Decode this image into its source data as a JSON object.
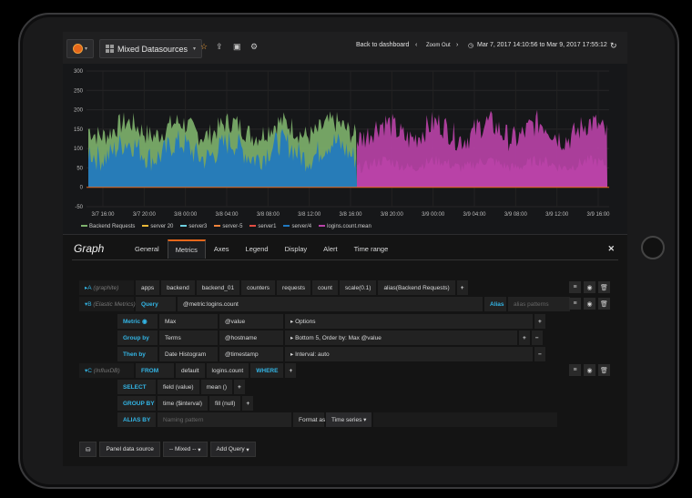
{
  "navbar": {
    "dashboard_title": "Mixed Datasources",
    "back_label": "Back to dashboard",
    "zoom_label": "Zoom Out",
    "time_range": "Mar 7, 2017 14:10:56 to Mar 9, 2017 17:55:12"
  },
  "chart_data": {
    "type": "area",
    "yticks": [
      "300",
      "250",
      "200",
      "150",
      "100",
      "50",
      "0",
      "-50"
    ],
    "ylim": [
      -50,
      300
    ],
    "xticks": [
      "3/7 16:00",
      "3/7 20:00",
      "3/8 00:00",
      "3/8 04:00",
      "3/8 08:00",
      "3/8 12:00",
      "3/8 16:00",
      "3/8 20:00",
      "3/9 00:00",
      "3/9 04:00",
      "3/9 08:00",
      "3/9 12:00",
      "3/9 16:00"
    ],
    "series": [
      {
        "name": "Backend Requests",
        "color": "#7eb26d"
      },
      {
        "name": "server 20",
        "color": "#eab839"
      },
      {
        "name": "server3",
        "color": "#6ed0e0"
      },
      {
        "name": "server-5",
        "color": "#ef843c"
      },
      {
        "name": "server1",
        "color": "#e24d42"
      },
      {
        "name": "server/4",
        "color": "#1f78c1"
      },
      {
        "name": "logins.count.mean",
        "color": "#ba43a9"
      }
    ]
  },
  "editor": {
    "title": "Graph",
    "tabs": [
      "General",
      "Metrics",
      "Axes",
      "Legend",
      "Display",
      "Alert",
      "Time range"
    ],
    "rowA": {
      "ref": "A",
      "ds": "(graphite)",
      "segments": [
        "apps",
        "backend",
        "backend_01",
        "counters",
        "requests",
        "count",
        "scale(0.1)",
        "alias(Backend Requests)"
      ]
    },
    "rowB": {
      "ref": "B",
      "ds": "(Elastic Metrics)",
      "query_label": "Query",
      "query_value": "@metric:logins.count",
      "alias_label": "Alias",
      "alias_placeholder": "alias patterns",
      "metric_label": "Metric",
      "metric_agg": "Max",
      "metric_field": "@value",
      "metric_opts": "Options",
      "groupby_label": "Group by",
      "groupby_agg": "Terms",
      "groupby_field": "@hostname",
      "groupby_opts": "Bottom 5, Order by: Max @value",
      "thenby_label": "Then by",
      "thenby_agg": "Date Histogram",
      "thenby_field": "@timestamp",
      "thenby_opts": "Interval: auto"
    },
    "rowC": {
      "ref": "C",
      "ds": "(InfluxDB)",
      "from_label": "FROM",
      "from_policy": "default",
      "from_measurement": "logins.count",
      "where_label": "WHERE",
      "select_label": "SELECT",
      "select_field": "field (value)",
      "select_fn": "mean ()",
      "groupby_label": "GROUP BY",
      "groupby_time": "time ($interval)",
      "groupby_fill": "fill (null)",
      "alias_label": "ALIAS BY",
      "alias_placeholder": "Naming pattern",
      "format_label": "Format as",
      "format_value": "Time series"
    },
    "bottom": {
      "panel_ds_label": "Panel data source",
      "mixed_label": "-- Mixed --",
      "add_query_label": "Add Query"
    }
  }
}
